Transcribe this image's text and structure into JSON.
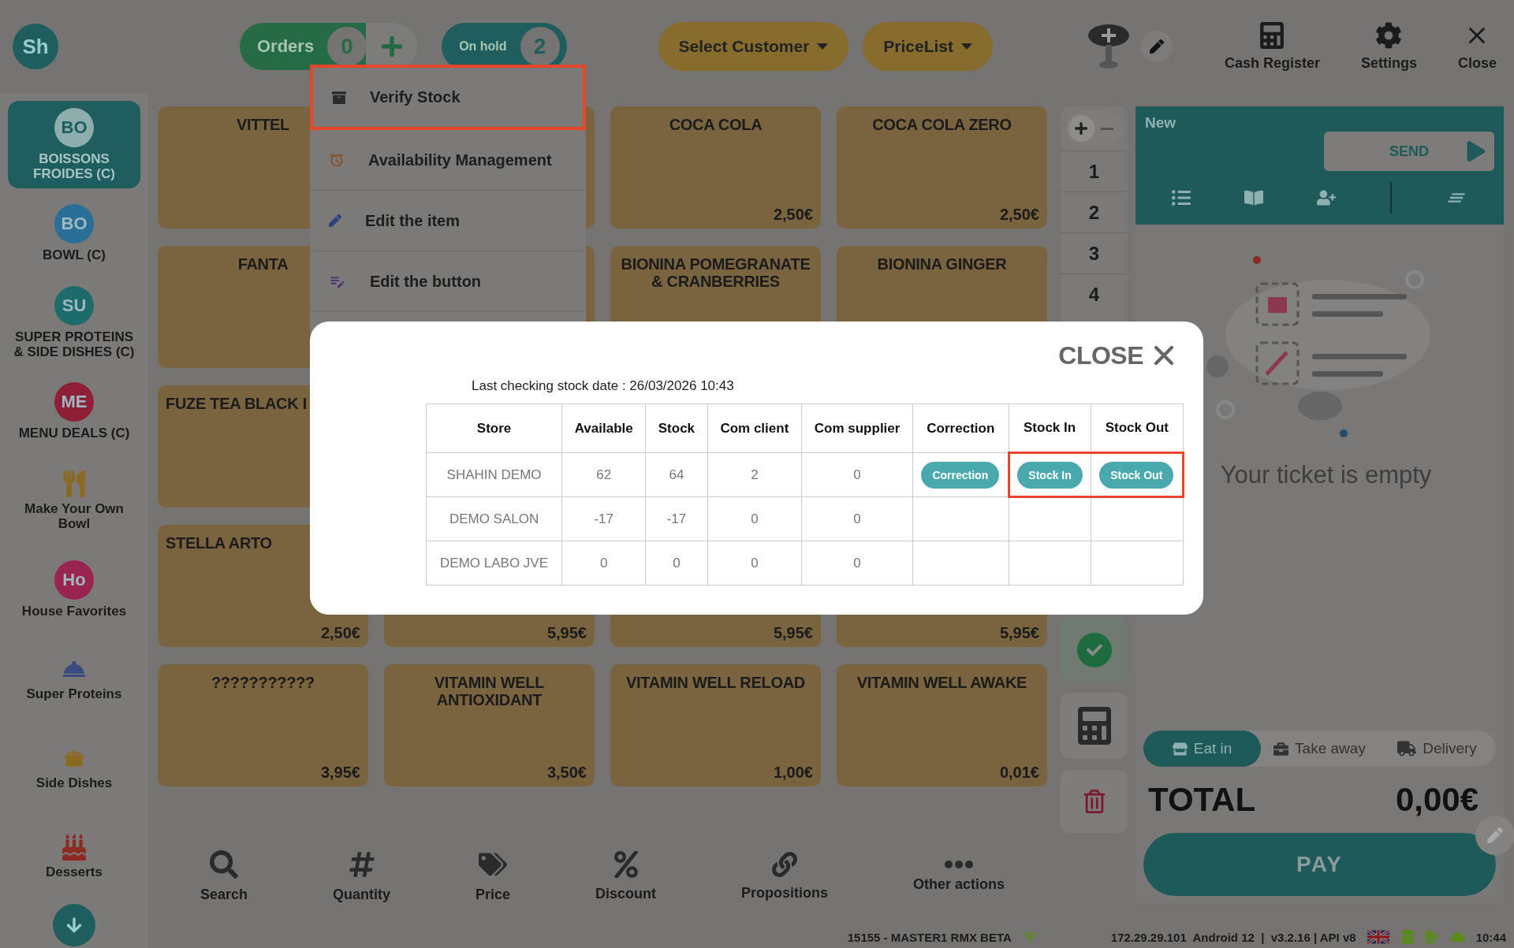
{
  "top_bar": {
    "avatar": "Sh",
    "orders": {
      "label": "Orders",
      "count": "0"
    },
    "on_hold": {
      "label": "On hold",
      "count": "2"
    },
    "customer_button": "Select Customer",
    "pricelist_button": "PriceList",
    "tools": [
      {
        "label": "Cash Register"
      },
      {
        "label": "Settings"
      },
      {
        "label": "Close"
      }
    ]
  },
  "sidebar": {
    "items": [
      {
        "kind": "badge",
        "badge": "BO",
        "label": "BOISSONS FROIDES (C)",
        "color": "#1f5e5f",
        "selected": true
      },
      {
        "kind": "badge",
        "badge": "BO",
        "label": "BOWL (C)",
        "color": "#2a6f97",
        "selected": false
      },
      {
        "kind": "badge",
        "badge": "SU",
        "label": "SUPER PROTEINS & SIDE DISHES (C)",
        "color": "#1e6b6b",
        "selected": false
      },
      {
        "kind": "badge",
        "badge": "ME",
        "label": "MENU DEALS (C)",
        "color": "#8e1f37",
        "selected": false
      },
      {
        "kind": "icon",
        "label": "Make Your Own Bowl",
        "selected": false
      },
      {
        "kind": "badge",
        "badge": "Ho",
        "label": "House Favorites",
        "color": "#9a2450",
        "selected": false
      },
      {
        "kind": "icon",
        "label": "Super Proteins",
        "selected": false
      },
      {
        "kind": "icon",
        "label": "Side Dishes",
        "selected": false
      },
      {
        "kind": "icon",
        "label": "Desserts",
        "selected": false
      }
    ]
  },
  "product_rows": [
    {
      "tiles": [
        {
          "kind": "product",
          "title": "VITTEL"
        },
        {
          "kind": "covered"
        },
        {
          "kind": "product",
          "title": "COCA COLA",
          "price": "2,50€"
        },
        {
          "kind": "product",
          "title": "COCA COLA ZERO",
          "price": "2,50€"
        }
      ]
    },
    {
      "tiles": [
        {
          "kind": "product",
          "title": "FANTA"
        },
        {
          "kind": "covered"
        },
        {
          "kind": "product",
          "title": "BIONINA POMEGRANATE & CRANBERRIES"
        },
        {
          "kind": "product",
          "title": "BIONINA GINGER"
        }
      ]
    },
    {
      "tiles": [
        {
          "kind": "product",
          "title": "FUZE TEA BLACK I",
          "clipped": true
        }
      ]
    },
    {
      "tiles": [
        {
          "kind": "product",
          "title": "STELLA ARTO",
          "clipped": true,
          "price": "2,50€"
        },
        {
          "kind": "product",
          "price": "5,95€"
        },
        {
          "kind": "product",
          "price": "5,95€"
        },
        {
          "kind": "product",
          "price": "5,95€"
        }
      ]
    },
    {
      "tiles": [
        {
          "kind": "product",
          "title": "???????????",
          "price": "3,95€"
        },
        {
          "kind": "product",
          "title": "VITAMIN WELL ANTIOXIDANT",
          "price": "3,50€"
        },
        {
          "kind": "product",
          "title": "VITAMIN WELL RELOAD",
          "price": "1,00€"
        },
        {
          "kind": "product",
          "title": "VITAMIN WELL AWAKE",
          "price": "0,01€"
        }
      ]
    }
  ],
  "number_pad": {
    "signs": [
      {
        "kind": "plus",
        "selected": true
      },
      {
        "kind": "minus",
        "selected": false
      }
    ],
    "numbers": [
      "1",
      "2",
      "3",
      "4"
    ]
  },
  "ticket": {
    "title": "New",
    "send": "SEND",
    "empty_text": "Your ticket is empty",
    "modes": [
      {
        "label": "Eat in",
        "selected": true
      },
      {
        "label": "Take away",
        "selected": false
      },
      {
        "label": "Delivery",
        "selected": false
      }
    ],
    "total_label": "TOTAL",
    "total": "0,00€",
    "pay": "PAY"
  },
  "actions": [
    {
      "label": "Search"
    },
    {
      "label": "Quantity"
    },
    {
      "label": "Price"
    },
    {
      "label": "Discount"
    },
    {
      "label": "Propositions"
    },
    {
      "label": "Other actions"
    }
  ],
  "status_bar": {
    "device": "15155 - MASTER1 RMX BETA",
    "info": "172.29.29.101  Android 12  |  v3.2.16 | API v8",
    "time": "10:44"
  },
  "context_menu": {
    "items": [
      {
        "label": "Verify Stock",
        "highlighted": true
      },
      {
        "label": "Availability Management",
        "highlighted": false
      },
      {
        "label": "Edit the item",
        "highlighted": false
      },
      {
        "label": "Edit the button",
        "highlighted": false
      }
    ]
  },
  "stock_dialog": {
    "close": "CLOSE",
    "last_check": "Last checking stock date : 26/03/2026 10:43",
    "columns": [
      "Store",
      "Available",
      "Stock",
      "Com client",
      "Com supplier",
      "Correction",
      "Stock In",
      "Stock Out"
    ],
    "rows": [
      {
        "cells": [
          "SHAHIN DEMO",
          "62",
          "64",
          "2",
          "0"
        ],
        "actions": [
          {
            "label": "Correction",
            "highlighted": false
          },
          {
            "label": "Stock In",
            "highlighted": true
          },
          {
            "label": "Stock Out",
            "highlighted": true
          }
        ]
      },
      {
        "cells": [
          "DEMO SALON",
          "-17",
          "-17",
          "0",
          "0"
        ]
      },
      {
        "cells": [
          "DEMO LABO JVE",
          "0",
          "0",
          "0",
          "0"
        ]
      }
    ]
  }
}
